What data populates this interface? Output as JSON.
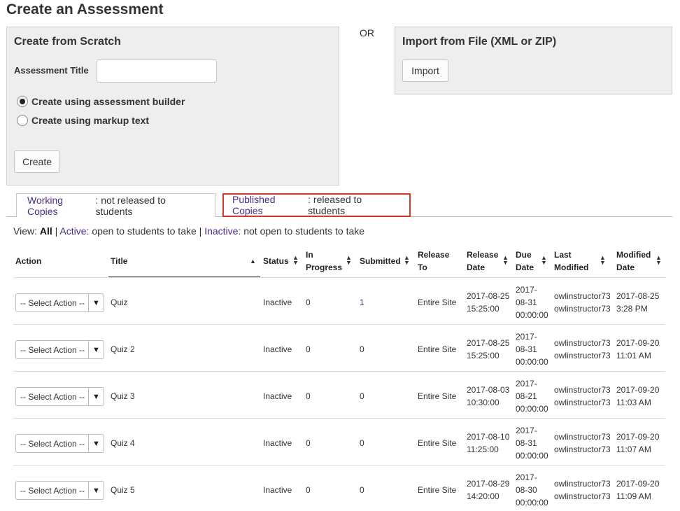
{
  "page": {
    "title": "Create an Assessment"
  },
  "scratch": {
    "heading": "Create from Scratch",
    "title_label": "Assessment Title",
    "title_value": "",
    "option_builder": "Create using assessment builder",
    "option_markup": "Create using markup text",
    "create_label": "Create"
  },
  "or_label": "OR",
  "import": {
    "heading": "Import from File (XML or ZIP)",
    "button_label": "Import"
  },
  "tabs": {
    "working": {
      "link": "Working Copies",
      "desc": ": not released to students"
    },
    "published": {
      "link": "Published Copies",
      "desc": ": released to students"
    }
  },
  "view": {
    "prefix": "View:",
    "all": "All",
    "sep1": "|",
    "active_link": "Active",
    "active_desc": ": open to students to take",
    "sep2": "|",
    "inactive_link": "Inactive",
    "inactive_desc": ": not open to students to take"
  },
  "table": {
    "headers": {
      "action": "Action",
      "title": "Title",
      "status": "Status",
      "in_progress_1": "In",
      "in_progress_2": "Progress",
      "submitted": "Submitted",
      "release_to_1": "Release",
      "release_to_2": "To",
      "release_date_1": "Release",
      "release_date_2": "Date",
      "due_date_1": "Due",
      "due_date_2": "Date",
      "last_modified_1": "Last",
      "last_modified_2": "Modified",
      "modified_date_1": "Modified",
      "modified_date_2": "Date"
    },
    "select_placeholder": "-- Select Action --",
    "rows": [
      {
        "title": "Quiz",
        "status": "Inactive",
        "in_progress": "0",
        "submitted": "1",
        "release_to": "Entire Site",
        "release_date": "2017-08-25",
        "release_time": "15:25:00",
        "due_1": "2017-",
        "due_2": "08-31",
        "due_3": "00:00:00",
        "modifier_1": "owlinstructor73",
        "modifier_2": "owlinstructor73",
        "mod_date": "2017-08-25",
        "mod_time": "3:28 PM"
      },
      {
        "title": "Quiz 2",
        "status": "Inactive",
        "in_progress": "0",
        "submitted": "0",
        "release_to": "Entire Site",
        "release_date": "2017-08-25",
        "release_time": "15:25:00",
        "due_1": "2017-",
        "due_2": "08-31",
        "due_3": "00:00:00",
        "modifier_1": "owlinstructor73",
        "modifier_2": "owlinstructor73",
        "mod_date": "2017-09-20",
        "mod_time": "11:01 AM"
      },
      {
        "title": "Quiz 3",
        "status": "Inactive",
        "in_progress": "0",
        "submitted": "0",
        "release_to": "Entire Site",
        "release_date": "2017-08-03",
        "release_time": "10:30:00",
        "due_1": "2017-",
        "due_2": "08-21",
        "due_3": "00:00:00",
        "modifier_1": "owlinstructor73",
        "modifier_2": "owlinstructor73",
        "mod_date": "2017-09-20",
        "mod_time": "11:03 AM"
      },
      {
        "title": "Quiz 4",
        "status": "Inactive",
        "in_progress": "0",
        "submitted": "0",
        "release_to": "Entire Site",
        "release_date": "2017-08-10",
        "release_time": "11:25:00",
        "due_1": "2017-",
        "due_2": "08-31",
        "due_3": "00:00:00",
        "modifier_1": "owlinstructor73",
        "modifier_2": "owlinstructor73",
        "mod_date": "2017-09-20",
        "mod_time": "11:07 AM"
      },
      {
        "title": "Quiz 5",
        "status": "Inactive",
        "in_progress": "0",
        "submitted": "0",
        "release_to": "Entire Site",
        "release_date": "2017-08-29",
        "release_time": "14:20:00",
        "due_1": "2017-",
        "due_2": "08-30",
        "due_3": "00:00:00",
        "modifier_1": "owlinstructor73",
        "modifier_2": "owlinstructor73",
        "mod_date": "2017-09-20",
        "mod_time": "11:09 AM"
      }
    ]
  },
  "colors": {
    "link": "#4a2b86",
    "highlight_border": "#d43a2a",
    "panel_bg": "#eeeeee"
  }
}
